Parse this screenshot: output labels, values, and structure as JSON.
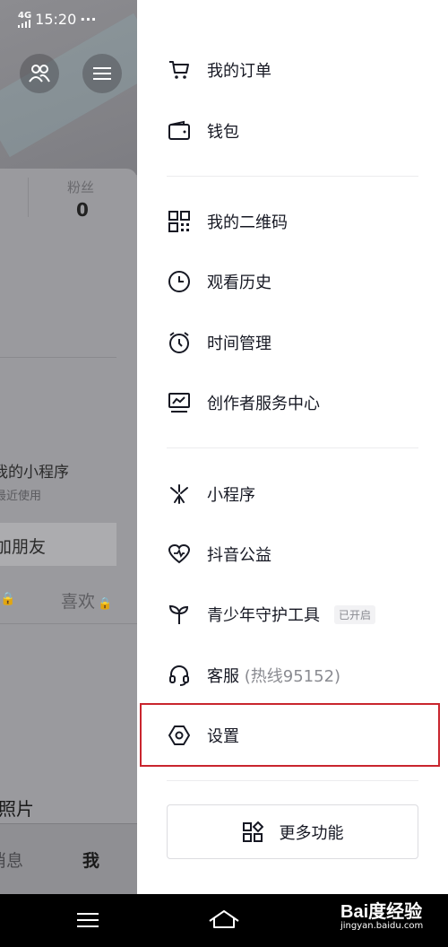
{
  "status_bar": {
    "network": "4G",
    "time": "15:20",
    "dots": "···"
  },
  "profile": {
    "fans_label": "粉丝",
    "fans_count": "0",
    "mini_programs": "我的小程序",
    "recent": "最近使用",
    "add_friend": "加朋友",
    "likes": "喜欢",
    "photos": "照片",
    "tab_messages": "消息",
    "tab_me": "我"
  },
  "drawer": {
    "items": [
      {
        "label": "我的订单",
        "icon": "cart-icon"
      },
      {
        "label": "钱包",
        "icon": "wallet-icon"
      },
      {
        "label": "我的二维码",
        "icon": "qr-code-icon"
      },
      {
        "label": "观看历史",
        "icon": "clock-icon"
      },
      {
        "label": "时间管理",
        "icon": "alarm-clock-icon"
      },
      {
        "label": "创作者服务中心",
        "icon": "chart-monitor-icon"
      },
      {
        "label": "小程序",
        "icon": "mini-program-icon"
      },
      {
        "label": "抖音公益",
        "icon": "heart-icon"
      },
      {
        "label": "青少年守护工具",
        "icon": "sprout-icon",
        "badge": "已开启"
      },
      {
        "label": "客服",
        "sub": "(热线95152)",
        "icon": "headset-icon"
      },
      {
        "label": "设置",
        "icon": "settings-hexagon-icon"
      }
    ],
    "more_button": "更多功能"
  },
  "watermark": {
    "main": "Bai度经验",
    "sub": "jingyan.baidu.com"
  }
}
